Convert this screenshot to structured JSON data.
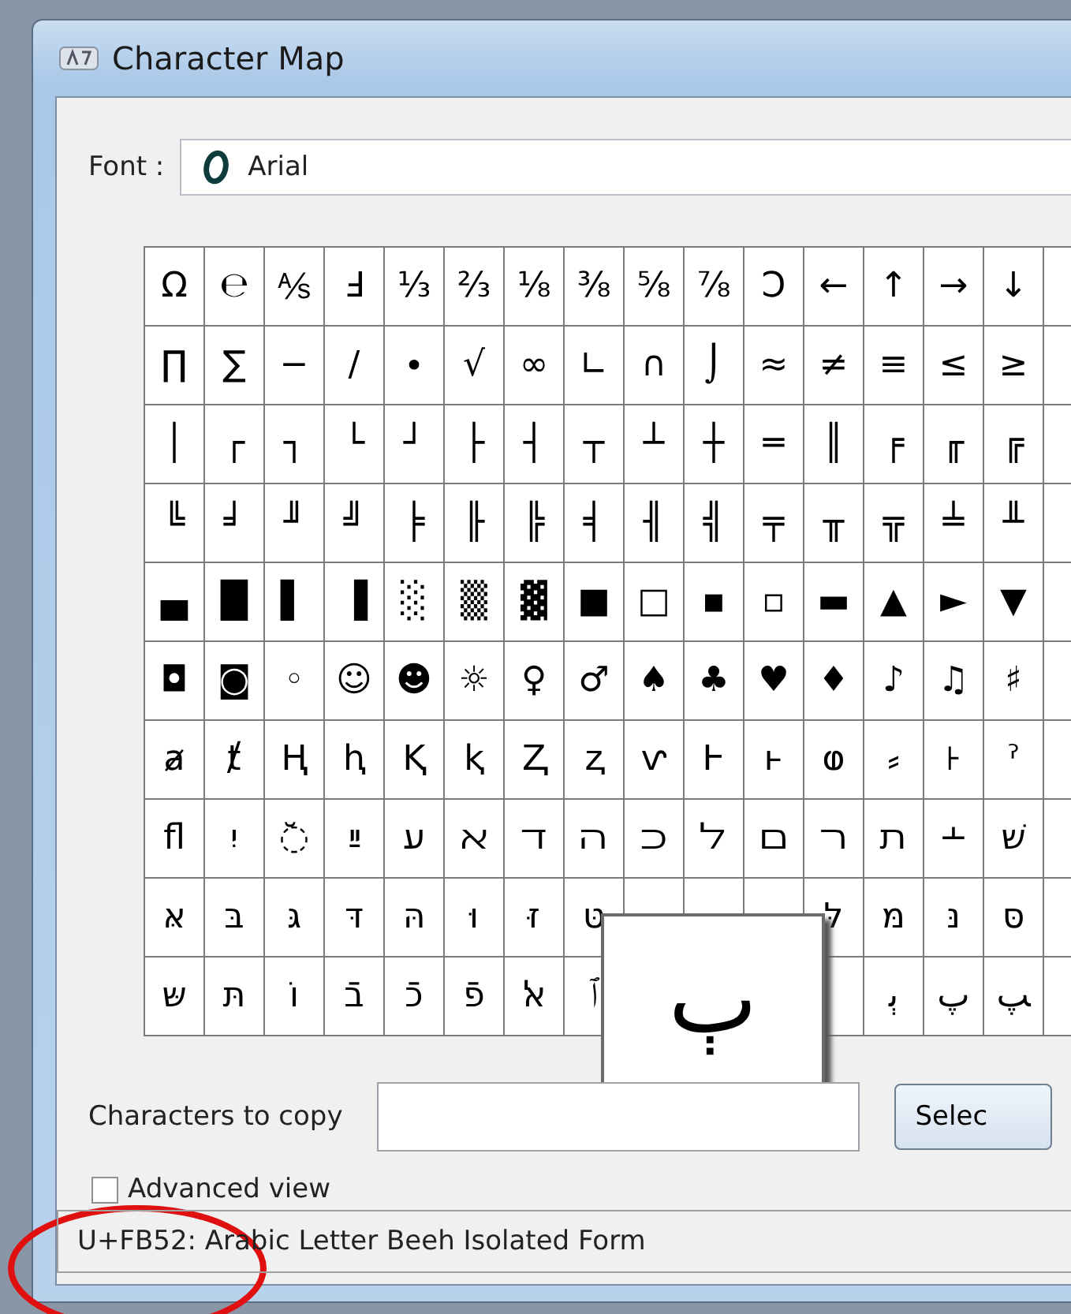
{
  "window": {
    "title": "Character Map"
  },
  "font": {
    "label": "Font :",
    "value": "Arial"
  },
  "grid": {
    "rows": [
      [
        "Ω",
        "℮",
        "⅍",
        "Ⅎ",
        "⅓",
        "⅔",
        "⅛",
        "⅜",
        "⅝",
        "⅞",
        "Ↄ",
        "←",
        "↑",
        "→",
        "↓"
      ],
      [
        "∏",
        "∑",
        "−",
        "∕",
        "∙",
        "√",
        "∞",
        "∟",
        "∩",
        "⌡",
        "≈",
        "≠",
        "≡",
        "≤",
        "≥"
      ],
      [
        "│",
        "┌",
        "┐",
        "└",
        "┘",
        "├",
        "┤",
        "┬",
        "┴",
        "┼",
        "═",
        "║",
        "╒",
        "╓",
        "╔"
      ],
      [
        "╚",
        "╛",
        "╜",
        "╝",
        "╞",
        "╟",
        "╠",
        "╡",
        "╢",
        "╣",
        "╤",
        "╥",
        "╦",
        "╧",
        "╨"
      ],
      [
        "▄",
        "█",
        "▌",
        "▐",
        "░",
        "▒",
        "▓",
        "■",
        "□",
        "▪",
        "▫",
        "▬",
        "▲",
        "►",
        "▼"
      ],
      [
        "◘",
        "◙",
        "◦",
        "☺",
        "☻",
        "☼",
        "♀",
        "♂",
        "♠",
        "♣",
        "♥",
        "♦",
        "♪",
        "♫",
        "♯"
      ],
      [
        "ⱥ",
        "ⱦ",
        "Ⱨ",
        "ⱨ",
        "Ⱪ",
        "ⱪ",
        "Ⱬ",
        "ⱬ",
        "ⱱ",
        "Ⱶ",
        "ⱶ",
        "ⱷ",
        "⸗",
        "꜔",
        "ˀ"
      ],
      [
        "ﬂ",
        "יִ",
        "◌ﬞ",
        "ײַ",
        "ﬠ",
        "ﬡ",
        "ﬢ",
        "ﬣ",
        "ﬤ",
        "ﬥ",
        "ﬦ",
        "ﬧ",
        "ﬨ",
        "﬩",
        "שׁ"
      ],
      [
        "אּ",
        "בּ",
        "גּ",
        "דּ",
        "הּ",
        "וּ",
        "זּ",
        "טּ",
        null,
        null,
        null,
        "לּ",
        "מּ",
        "נּ",
        "סּ"
      ],
      [
        "שּ",
        "תּ",
        "וֹ",
        "בֿ",
        "כֿ",
        "פֿ",
        "ﭏ",
        "ﭐ",
        null,
        null,
        null,
        null,
        "ﭔ",
        "ﭖ",
        "ﭗ"
      ]
    ]
  },
  "popup": {
    "char": "ﭒ"
  },
  "copy": {
    "label": "Characters to copy",
    "button": "Selec"
  },
  "advanced": {
    "label": "Advanced view",
    "checked": false
  },
  "status_bar": "U+FB52: Arabic Letter Beeh Isolated Form",
  "annotation": {
    "kind": "circle"
  }
}
